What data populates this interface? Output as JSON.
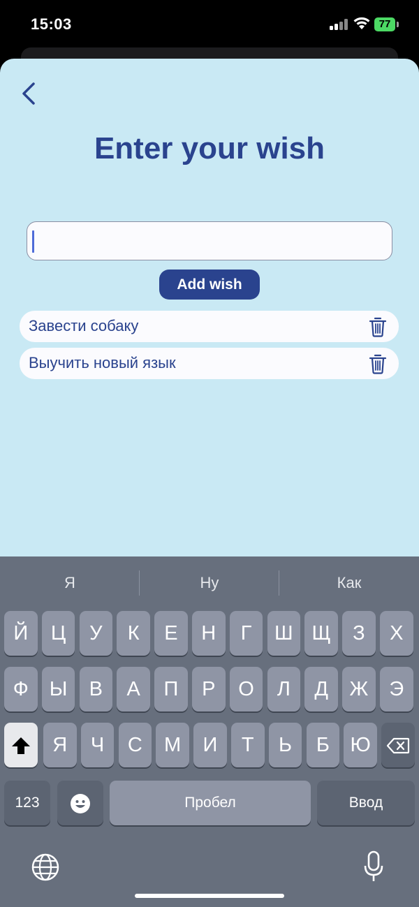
{
  "status_bar": {
    "time": "15:03",
    "battery": "77"
  },
  "screen": {
    "title": "Enter your wish",
    "input_value": "",
    "add_button_label": "Add wish",
    "wishes": [
      {
        "text": "Завести собаку"
      },
      {
        "text": "Выучить новый язык"
      }
    ]
  },
  "keyboard": {
    "suggestions": [
      "Я",
      "Ну",
      "Как"
    ],
    "row1": [
      "Й",
      "Ц",
      "У",
      "К",
      "Е",
      "Н",
      "Г",
      "Ш",
      "Щ",
      "З",
      "Х"
    ],
    "row2": [
      "Ф",
      "Ы",
      "В",
      "А",
      "П",
      "Р",
      "О",
      "Л",
      "Д",
      "Ж",
      "Э"
    ],
    "row3": [
      "Я",
      "Ч",
      "С",
      "М",
      "И",
      "Т",
      "Ь",
      "Б",
      "Ю"
    ],
    "numbers_key": "123",
    "space_key": "Пробел",
    "return_key": "Ввод"
  },
  "colors": {
    "accent": "#2a438e",
    "background": "#c9e9f4",
    "keyboard": "#676f7d"
  }
}
